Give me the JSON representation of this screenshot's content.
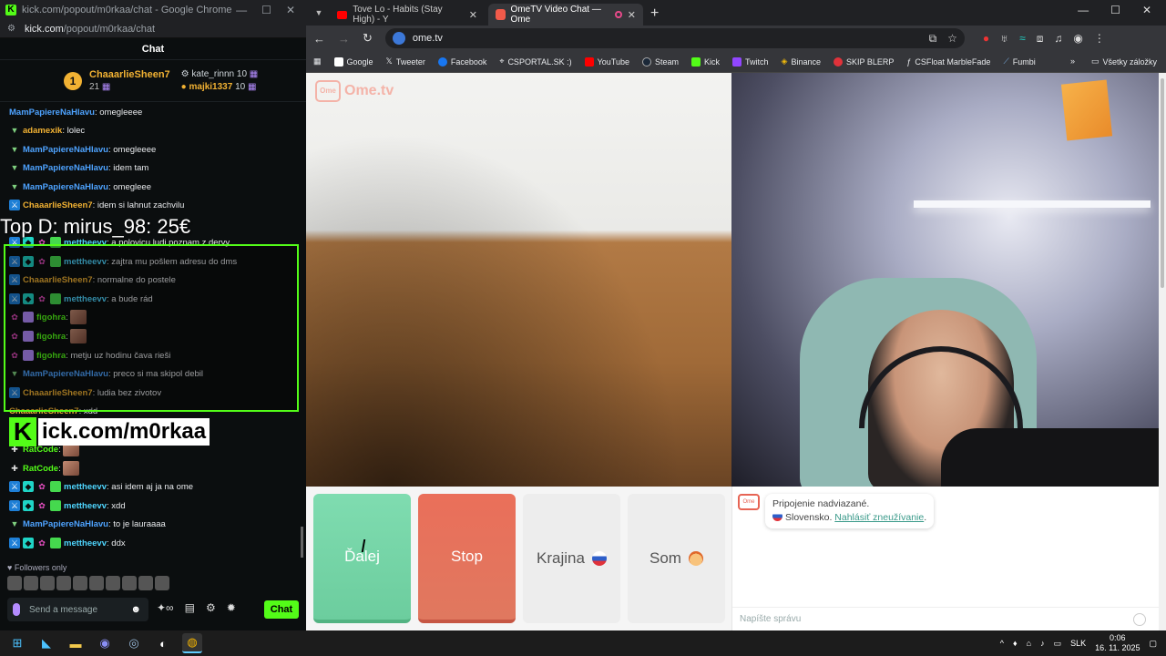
{
  "left_window": {
    "title": "kick.com/popout/m0rkaa/chat - Google Chrome",
    "url_host": "kick.com",
    "url_path": "/popout/m0rkaa/chat",
    "chat_header": "Chat",
    "pinned": {
      "rank": "1",
      "top_name": "ChaaarlieSheen7",
      "top_count": "21",
      "second_name": "kate_rinnn",
      "second_count": "10",
      "third_name": "majki1337",
      "third_count": "10"
    },
    "messages": [
      {
        "user": "MamPapiereNaHlavu",
        "text": "omegleeee"
      },
      {
        "user": "adamexik",
        "text": "lolec"
      },
      {
        "user": "MamPapiereNaHlavu",
        "text": "omegleeee"
      },
      {
        "user": "MamPapiereNaHlavu",
        "text": "idem tam"
      },
      {
        "user": "MamPapiereNaHlavu",
        "text": "omegleee"
      },
      {
        "user": "ChaaarlieSheen7",
        "text": "idem si lahnut zachvilu"
      },
      {
        "user": "mettheevv",
        "text": "a polovicu ludi poznam z dervy"
      },
      {
        "user": "mettheevv",
        "text": "zajtra mu pošlem adresu do dms"
      },
      {
        "user": "ChaaarlieSheen7",
        "text": "normalne do postele"
      },
      {
        "user": "mettheevv",
        "text": "a bude rád"
      },
      {
        "user": "figohra",
        "text": ""
      },
      {
        "user": "figohra",
        "text": ""
      },
      {
        "user": "figohra",
        "text": "metju uz hodinu čava rieši"
      },
      {
        "user": "MamPapiereNaHlavu",
        "text": "preco si ma skipol debil"
      },
      {
        "user": "ChaaarlieSheen7",
        "text": "ludia bez zivotov"
      },
      {
        "user": "ChaaarlieSheen7",
        "text": "xdd"
      },
      {
        "user": "RatCode",
        "text": ""
      },
      {
        "user": "RatCode",
        "text": ""
      },
      {
        "user": "mettheevv",
        "text": "asi idem aj ja na ome"
      },
      {
        "user": "mettheevv",
        "text": "xdd"
      },
      {
        "user": "MamPapiereNaHlavu",
        "text": "to je lauraaaa"
      },
      {
        "user": "mettheevv",
        "text": "ddx"
      }
    ],
    "overlay_top": "Top D: mirus_98: 25€",
    "overlay_logo_k": "K",
    "overlay_logo_text": "ick.com/m0rkaa",
    "followers_only": "Followers only",
    "input_placeholder": "Send a message",
    "chat_button": "Chat"
  },
  "browser": {
    "tabs": [
      {
        "label": "Tove Lo - Habits (Stay High) - Y",
        "icon": "youtube-icon"
      },
      {
        "label": "OmeTV Video Chat — Ome",
        "icon": "ometv-icon"
      }
    ],
    "url": "ome.tv",
    "bookmarks": [
      "Google",
      "Tweeter",
      "Facebook",
      "CSPORTAL.SK :)",
      "YouTube",
      "Steam",
      "Kick",
      "Twitch",
      "Binance",
      "SKIP BLERP",
      "CSFloat MarbleFade",
      "Fumbi"
    ],
    "bookmarks_all": "Všetky záložky"
  },
  "ometv": {
    "logo_text": "Ome.tv",
    "buttons": {
      "next": "Ďalej",
      "stop": "Stop",
      "country": "Krajina",
      "me": "Som"
    },
    "system_message": "Pripojenie nadviazané.",
    "country_text": "Slovensko.",
    "report_link": "Nahlásiť zneužívanie",
    "message_placeholder": "Napíšte správu"
  },
  "taskbar": {
    "lang": "SLK",
    "time": "0:06",
    "date": "16. 11. 2025"
  },
  "colors": {
    "kick_green": "#53fc18",
    "next_green": "#7fdcb0",
    "stop_red": "#ea6f5a"
  }
}
